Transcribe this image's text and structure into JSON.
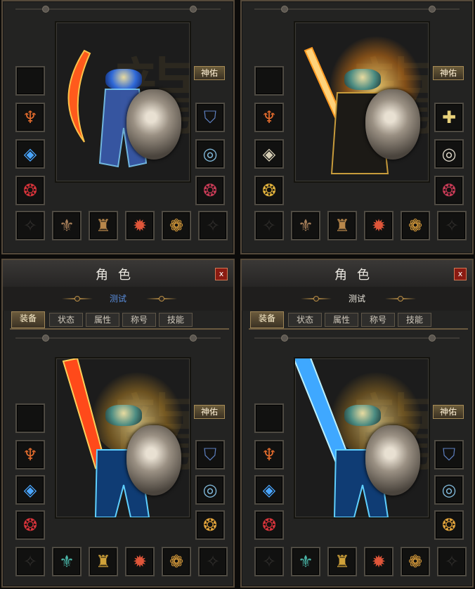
{
  "panels": [
    {
      "has_titlebar": false,
      "shenyou_label": "神佑",
      "slots_left": [
        "empty",
        "necklace",
        "bracelet",
        "ring"
      ],
      "slots_right": [
        "helmet-slot",
        "necklace",
        "ring"
      ],
      "slots_bottom": [
        "empty",
        "belt",
        "boots",
        "gem",
        "medal",
        "empty"
      ]
    },
    {
      "has_titlebar": false,
      "shenyou_label": "神佑",
      "slots_left": [
        "empty",
        "necklace",
        "bracelet",
        "ring"
      ],
      "slots_right": [
        "cross",
        "bracer",
        "ring"
      ],
      "slots_bottom": [
        "empty",
        "belt",
        "boots",
        "gem",
        "medal",
        "empty"
      ]
    },
    {
      "has_titlebar": true,
      "title": "角色",
      "close_label": "x",
      "subtitle": "测试",
      "tabs": [
        "装备",
        "状态",
        "属性",
        "称号",
        "技能"
      ],
      "active_tab": 0,
      "shenyou_label": "神佑"
    },
    {
      "has_titlebar": true,
      "title": "角色",
      "close_label": "x",
      "subtitle": "测试",
      "tabs": [
        "装备",
        "状态",
        "属性",
        "称号",
        "技能"
      ],
      "active_tab": 0,
      "shenyou_label": "神佑"
    }
  ],
  "colors": {
    "gold": "#b78d45",
    "subtitle_blue": "#5a8fe0",
    "close_red": "#8a1b12"
  },
  "icons": {
    "necklace": "necklace-icon",
    "bracelet": "bracelet-icon",
    "ring": "ring-icon",
    "belt": "belt-icon",
    "boots": "boots-icon",
    "gem": "gem-icon",
    "medal": "medal-icon"
  }
}
